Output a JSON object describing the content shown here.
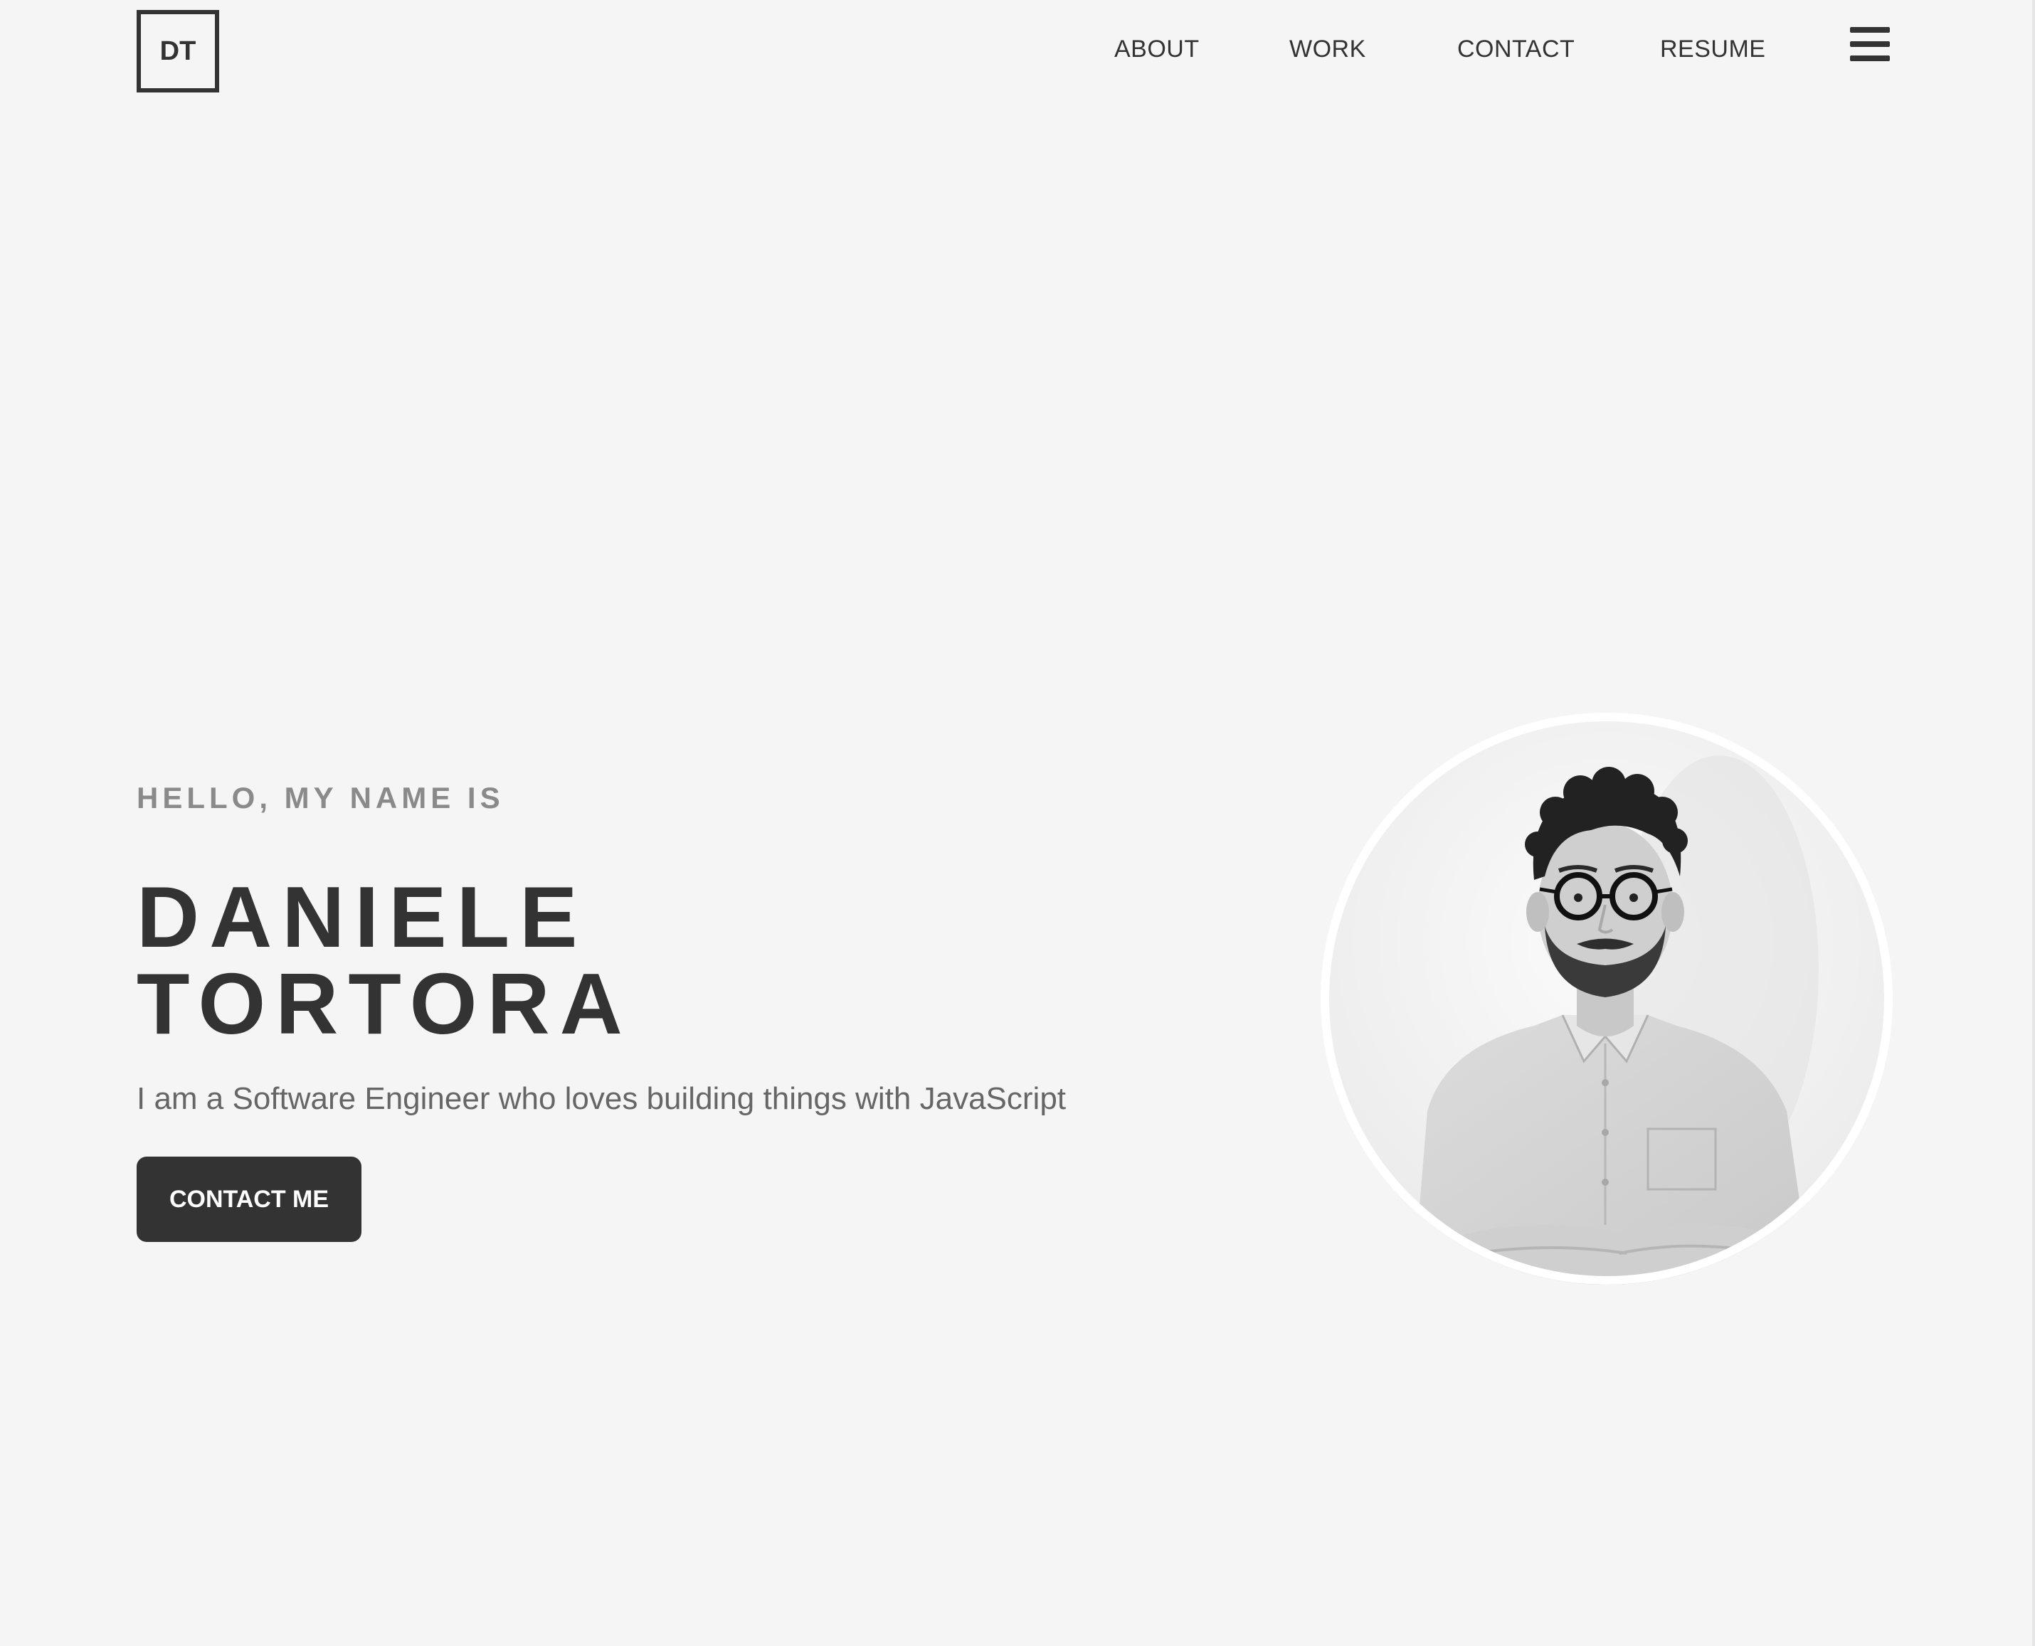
{
  "header": {
    "logo_text": "DT",
    "nav": {
      "about": "ABOUT",
      "work": "WORK",
      "contact": "CONTACT",
      "resume": "RESUME"
    },
    "menu_icon": "hamburger-menu-icon"
  },
  "hero": {
    "greeting": "HELLO, MY NAME IS",
    "first_name": "DANIELE",
    "last_name": "TORTORA",
    "tagline": "I am a Software Engineer who loves building things with JavaScript",
    "cta_label": "CONTACT ME",
    "portrait": "profile-photo"
  },
  "colors": {
    "background": "#f5f5f5",
    "text_dark": "#333333",
    "text_muted": "#8a8a8a",
    "button_bg": "#333333",
    "button_text": "#ffffff"
  }
}
